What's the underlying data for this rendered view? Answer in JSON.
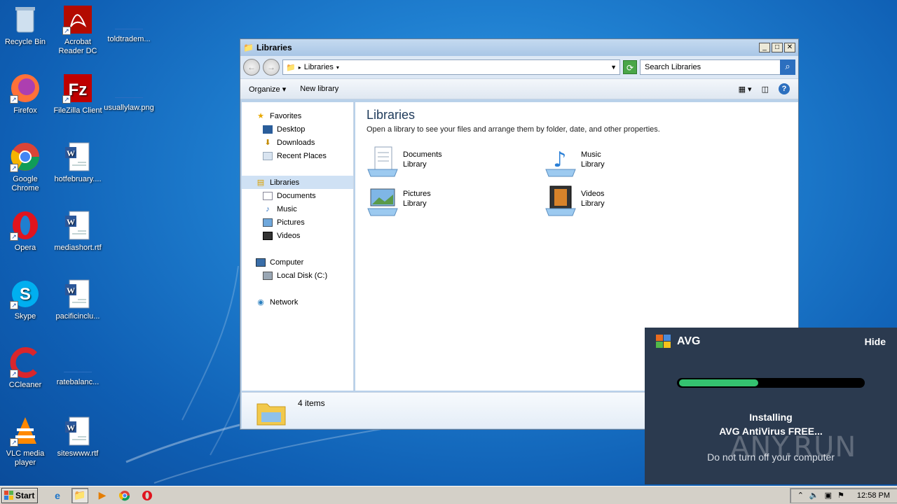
{
  "desktop": {
    "icons": [
      {
        "label": "Recycle Bin",
        "icon": "recycle-bin-icon"
      },
      {
        "label": "Acrobat Reader DC",
        "icon": "acrobat-icon"
      },
      {
        "label": "toldtradem...",
        "icon": "blank-file-icon"
      },
      {
        "label": "Firefox",
        "icon": "firefox-icon"
      },
      {
        "label": "FileZilla Client",
        "icon": "filezilla-icon"
      },
      {
        "label": "usuallylaw.png",
        "icon": "blank-file-icon"
      },
      {
        "label": "Google Chrome",
        "icon": "chrome-icon"
      },
      {
        "label": "hotfebruary....",
        "icon": "word-doc-icon"
      },
      {
        "label": "Opera",
        "icon": "opera-icon"
      },
      {
        "label": "mediashort.rtf",
        "icon": "word-doc-icon"
      },
      {
        "label": "Skype",
        "icon": "skype-icon"
      },
      {
        "label": "pacificinclu...",
        "icon": "word-doc-icon"
      },
      {
        "label": "CCleaner",
        "icon": "ccleaner-icon"
      },
      {
        "label": "ratebalanc...",
        "icon": "blank-file-icon"
      },
      {
        "label": "VLC media player",
        "icon": "vlc-icon"
      },
      {
        "label": "siteswww.rtf",
        "icon": "word-doc-icon"
      }
    ]
  },
  "window": {
    "title": "Libraries",
    "address": "Libraries",
    "search_placeholder": "Search Libraries",
    "cmd": {
      "organize": "Organize",
      "new_library": "New library"
    },
    "nav": {
      "favorites": "Favorites",
      "desktop": "Desktop",
      "downloads": "Downloads",
      "recent": "Recent Places",
      "libraries": "Libraries",
      "documents": "Documents",
      "music": "Music",
      "pictures": "Pictures",
      "videos": "Videos",
      "computer": "Computer",
      "local_disk": "Local Disk (C:)",
      "network": "Network"
    },
    "content": {
      "heading": "Libraries",
      "subheading": "Open a library to see your files and arrange them by folder, date, and other properties.",
      "libraries": [
        {
          "name": "Documents",
          "kind": "Library"
        },
        {
          "name": "Music",
          "kind": "Library"
        },
        {
          "name": "Pictures",
          "kind": "Library"
        },
        {
          "name": "Videos",
          "kind": "Library"
        }
      ]
    },
    "details": "4 items"
  },
  "avg": {
    "brand": "AVG",
    "hide": "Hide",
    "progress": 0.42,
    "status_line1": "Installing",
    "status_line2": "AVG AntiVirus FREE...",
    "warning": "Do not turn off your computer",
    "watermark": "ANY.RUN"
  },
  "taskbar": {
    "start": "Start",
    "clock": "12:58 PM"
  },
  "colors": {
    "avg_bg": "#2b3a4f",
    "avg_progress": "#34c270",
    "desktop_blue": "#1f7fd0"
  }
}
